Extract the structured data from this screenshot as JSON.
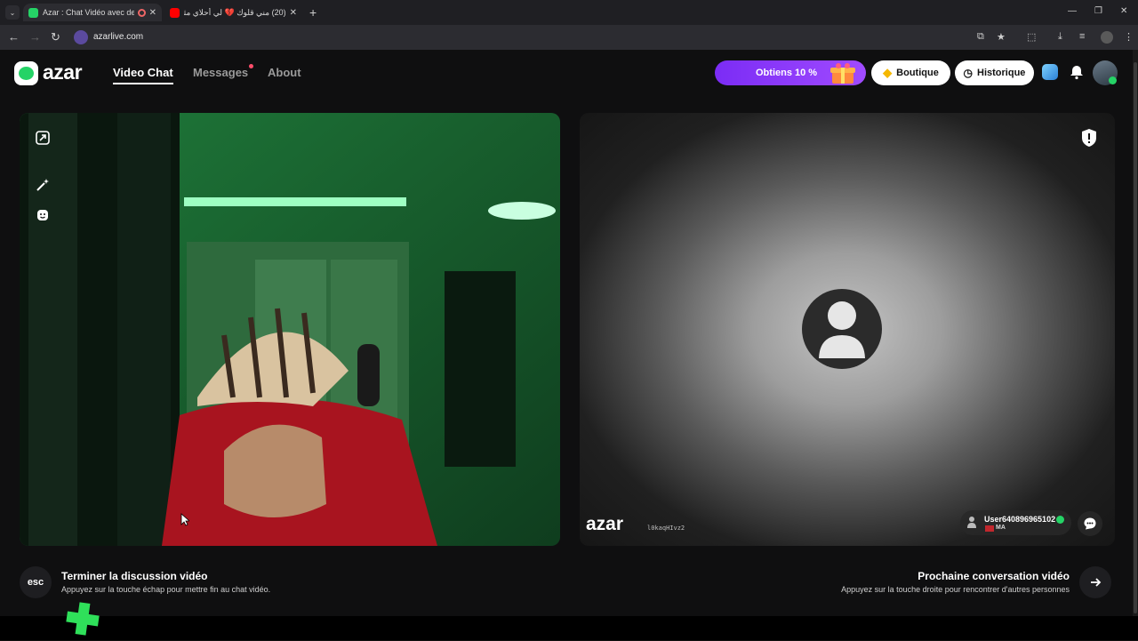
{
  "browser": {
    "tabs": [
      {
        "title": "Azar : Chat Vidéo avec de",
        "favicon_color": "#25d366"
      },
      {
        "title": "(20) مني قلوك 💔 لي أحلاي مثان",
        "favicon_color": "#ff0000"
      }
    ],
    "close_glyph": "✕",
    "new_tab_glyph": "+",
    "url": "azarlive.com",
    "window_controls": [
      "—",
      "❐",
      "✕"
    ]
  },
  "header": {
    "logo_text": "azar",
    "nav": [
      {
        "label": "Video Chat",
        "active": true
      },
      {
        "label": "Messages",
        "active": false,
        "has_dot": true
      },
      {
        "label": "About",
        "active": false
      }
    ],
    "promo_label": "Obtiens 10 %",
    "shop_label": "Boutique",
    "history_label": "Historique",
    "accent_color": "#8a35ff"
  },
  "local_video": {
    "controls": [
      "expand-icon",
      "magic-wand-icon",
      "face-sticker-icon"
    ]
  },
  "remote_video": {
    "watermark_logo": "azar",
    "watermark_id": "l0kaqHIvz2",
    "username": "User640896965102",
    "country": "MA",
    "report_icon": "shield-alert-icon"
  },
  "footer": {
    "esc_key": "esc",
    "end_title": "Terminer la discussion vidéo",
    "end_sub": "Appuyez sur la touche échap pour mettre fin au chat vidéo.",
    "next_title": "Prochaine conversation vidéo",
    "next_sub": "Appuyez sur la touche droite pour rencontrer d'autres personnes"
  }
}
